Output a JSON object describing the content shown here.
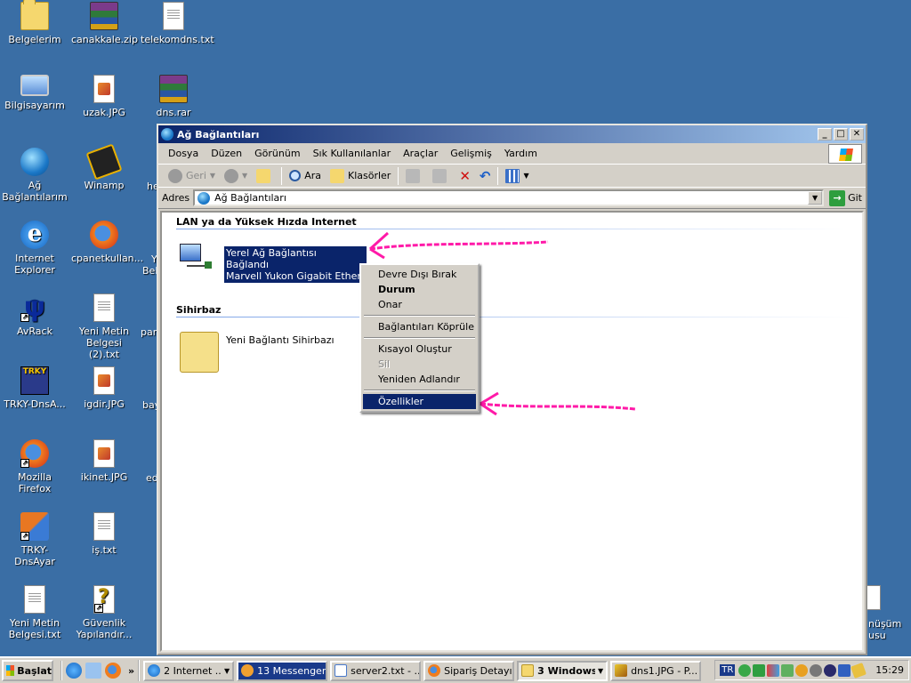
{
  "desktop": {
    "icons": [
      {
        "label": "Belgelerim"
      },
      {
        "label": "canakkale.zip"
      },
      {
        "label": "telekomdns.txt"
      },
      {
        "label": "Bilgisayarım"
      },
      {
        "label": "uzak.JPG"
      },
      {
        "label": "dns.rar"
      },
      {
        "label": "Ağ Bağlantılarım"
      },
      {
        "label": "Winamp"
      },
      {
        "label": "Internet Explorer"
      },
      {
        "label": "cpanetkullan..."
      },
      {
        "label": "AvRack"
      },
      {
        "label": "Yeni Metin Belgesi (2).txt"
      },
      {
        "label": "TRKY-DnsA..."
      },
      {
        "label": "igdir.JPG"
      },
      {
        "label": "Mozilla Firefox"
      },
      {
        "label": "ikinet.JPG"
      },
      {
        "label": "TRKY-DnsAyar"
      },
      {
        "label": "iş.txt"
      },
      {
        "label": "Yeni Metin Belgesi.txt"
      },
      {
        "label": "Güvenlik Yapılandır..."
      }
    ],
    "clipped_labels": [
      "he",
      "Y",
      "Bel",
      "pam",
      "bay",
      "ed",
      "nüşüm",
      "usu"
    ],
    "trky_icon_text": "TRKY"
  },
  "window": {
    "title": "Ağ Bağlantıları",
    "controls": {
      "minimize": "_",
      "maximize": "□",
      "close": "✕"
    },
    "menu": [
      "Dosya",
      "Düzen",
      "Görünüm",
      "Sık Kullanılanlar",
      "Araçlar",
      "Gelişmiş",
      "Yardım"
    ],
    "toolbar": {
      "back": "Geri",
      "search": "Ara",
      "folders": "Klasörler"
    },
    "address": {
      "label": "Adres",
      "value": "Ağ Bağlantıları",
      "go": "Git"
    },
    "groups": {
      "lan": "LAN ya da Yüksek Hızda Internet",
      "wizard": "Sihirbaz"
    },
    "connection": {
      "name": "Yerel Ağ Bağlantısı",
      "status": "Bağlandı",
      "device": "Marvell Yukon Gigabit Etherne..."
    },
    "wizard_item": "Yeni Bağlantı Sihirbazı"
  },
  "context_menu": {
    "items": [
      {
        "label": "Devre Dışı Bırak",
        "style": "normal"
      },
      {
        "label": "Durum",
        "style": "bold"
      },
      {
        "label": "Onar",
        "style": "normal"
      },
      {
        "label": "Bağlantıları Köprüle",
        "style": "normal"
      },
      {
        "label": "Kısayol Oluştur",
        "style": "normal"
      },
      {
        "label": "Sil",
        "style": "disabled"
      },
      {
        "label": "Yeniden Adlandır",
        "style": "normal"
      },
      {
        "label": "Özellikler",
        "style": "selected"
      }
    ]
  },
  "taskbar": {
    "start": "Başlat",
    "more": "»",
    "tasks": [
      {
        "label": "2 Internet ...",
        "dropdown": true,
        "state": "normal"
      },
      {
        "label": "13 Messenger",
        "dropdown": false,
        "state": "dark"
      },
      {
        "label": "server2.txt - ...",
        "dropdown": false,
        "state": "normal"
      },
      {
        "label": "Sipariş Detayı...",
        "dropdown": false,
        "state": "normal"
      },
      {
        "label": "3 Windows...",
        "dropdown": true,
        "state": "active"
      },
      {
        "label": "dns1.JPG - P...",
        "dropdown": false,
        "state": "normal"
      }
    ],
    "lang": "TR",
    "clock": "15:29"
  },
  "colors": {
    "desktop": "#3a6ea5",
    "selection": "#0a246a",
    "annotation_arrow": "#ff1aa8"
  }
}
